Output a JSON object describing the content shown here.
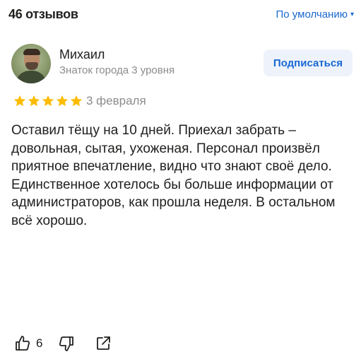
{
  "header": {
    "reviews_count": "46 отзывов",
    "sort_label": "По умолчанию",
    "sort_caret": "▾"
  },
  "review": {
    "author": {
      "name": "Михаил",
      "level": "Знаток города 3 уровня"
    },
    "subscribe_label": "Подписаться",
    "rating": 5,
    "rating_max": 5,
    "date": "3 февраля",
    "text": "Оставил тёщу на 10 дней. Приехал забрать – довольная, сытая, ухоженая. Персонал произвёл приятное впечатление, видно что знают своё дело. Единственное хотелось бы больше информации от администраторов, как прошла неделя. В остальном всё хорошо.",
    "likes": "6"
  },
  "colors": {
    "accent": "#1968d2",
    "star": "#fcbc05",
    "text": "#21201f",
    "muted": "#8c8c8c",
    "button_bg": "#eef3fb"
  },
  "icons": {
    "like": "thumb-up-icon",
    "dislike": "thumb-down-icon",
    "share": "share-icon",
    "star": "star-icon"
  }
}
